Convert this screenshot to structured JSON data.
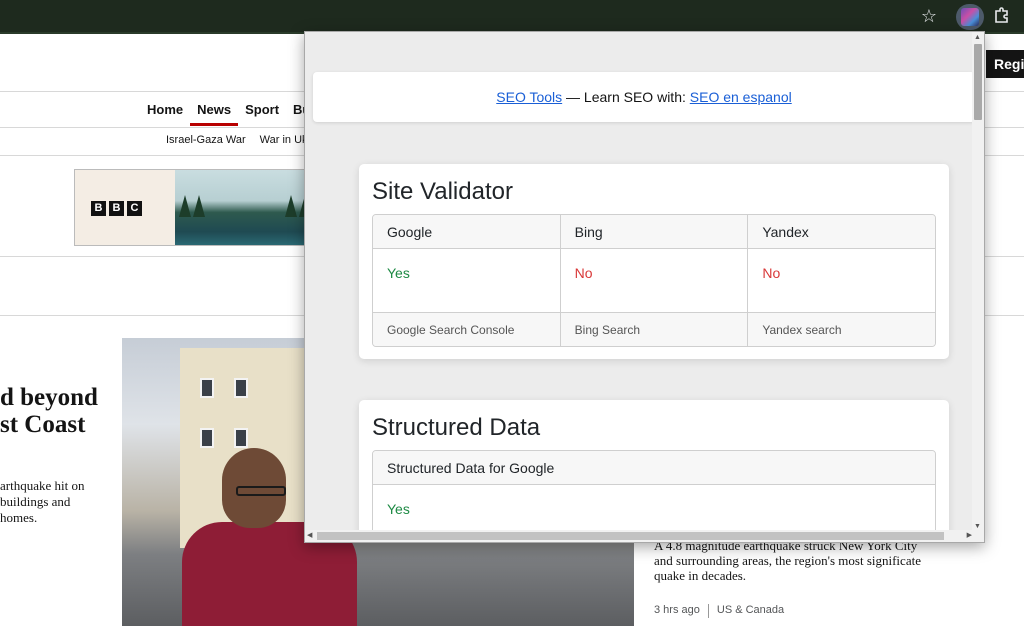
{
  "browser": {
    "star_icon": "star-icon",
    "extension_icon": "seo-extension-icon",
    "puzzle_icon": "puzzle-icon"
  },
  "page": {
    "register_label": "Regis",
    "nav": [
      "Home",
      "News",
      "Sport",
      "Busin"
    ],
    "active_nav": "News",
    "subnav": [
      "Israel-Gaza War",
      "War in Ukr"
    ],
    "ad_logo": [
      "B",
      "B",
      "C"
    ],
    "headline_lines": [
      "d beyond",
      "st Coast"
    ],
    "summary_lines": [
      "arthquake hit on",
      "buildings and",
      "homes."
    ],
    "side_text": "A 4.8 magnitude earthquake struck New York City and surrounding areas, the region's most significate quake in decades.",
    "side_time": "3 hrs ago",
    "side_section": "US & Canada"
  },
  "popup": {
    "header": {
      "link1": "SEO Tools",
      "middle": " — Learn SEO with: ",
      "link2": "SEO en espanol"
    },
    "site_validator": {
      "title": "Site Validator",
      "columns": [
        "Google",
        "Bing",
        "Yandex"
      ],
      "values": [
        "Yes",
        "No",
        "No"
      ],
      "footers": [
        "Google Search Console",
        "Bing Search",
        "Yandex search"
      ]
    },
    "structured_data": {
      "title": "Structured Data",
      "column": "Structured Data for Google",
      "value": "Yes"
    }
  },
  "colors": {
    "yes": "#1e8a44",
    "no": "#d93838",
    "link": "#1a5fd6",
    "bbc_red": "#b80000"
  }
}
